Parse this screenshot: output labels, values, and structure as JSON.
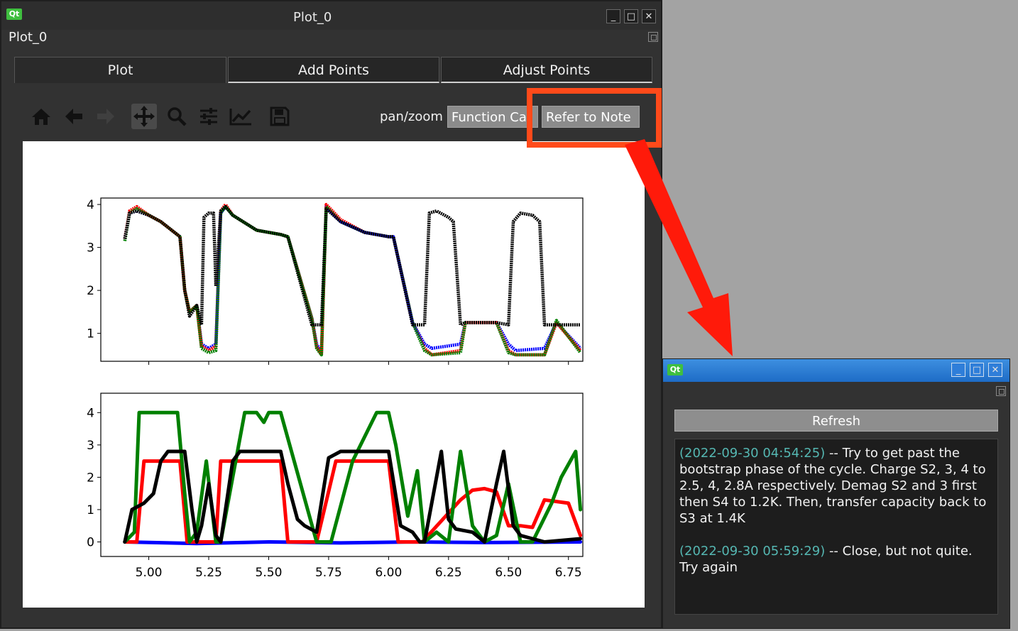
{
  "main_window": {
    "title": "Plot_0",
    "dock_label": "Plot_0",
    "controls": {
      "minimize": "_",
      "maximize": "□",
      "close": "✕"
    }
  },
  "tabs": [
    {
      "label": "Plot",
      "active": true
    },
    {
      "label": "Add Points",
      "active": false
    },
    {
      "label": "Adjust Points",
      "active": false
    }
  ],
  "toolbar": {
    "icons": [
      "home-icon",
      "back-arrow-icon",
      "forward-arrow-icon",
      "pan-move-icon",
      "zoom-icon",
      "configure-subplots-icon",
      "edit-axis-icon",
      "save-icon"
    ],
    "mode_label": "pan/zoom",
    "function_button_label": "Function Ca",
    "refer_button_label": "Refer to Note"
  },
  "annotation": {
    "color": "#ff4a1a",
    "arrow_color": "#ff1a0a"
  },
  "chart_data": [
    {
      "type": "scatter",
      "title": "",
      "xlabel": "",
      "ylabel": "",
      "xlim": [
        4.8,
        6.81
      ],
      "ylim": [
        0.35,
        4.15
      ],
      "yticks": [
        "1",
        "2",
        "3",
        "4"
      ],
      "series": [
        {
          "color": "#0000ff",
          "x": [
            4.9,
            4.92,
            4.95,
            5.0,
            5.05,
            5.13,
            5.15,
            5.17,
            5.2,
            5.22,
            5.25,
            5.28,
            5.3,
            5.32,
            5.35,
            5.45,
            5.55,
            5.58,
            5.68,
            5.7,
            5.72,
            5.74,
            5.8,
            5.9,
            6.0,
            6.02,
            6.1,
            6.15,
            6.18,
            6.3,
            6.32,
            6.45,
            6.5,
            6.53,
            6.65,
            6.7,
            6.8
          ],
          "y": [
            3.2,
            3.8,
            3.85,
            3.75,
            3.6,
            3.25,
            2.0,
            1.5,
            1.65,
            0.75,
            0.65,
            0.75,
            3.8,
            3.95,
            3.75,
            3.4,
            3.3,
            3.25,
            1.35,
            0.75,
            0.55,
            3.95,
            3.6,
            3.35,
            3.25,
            3.25,
            1.25,
            0.75,
            0.65,
            0.75,
            1.25,
            1.25,
            0.75,
            0.6,
            0.65,
            1.25,
            0.65
          ]
        },
        {
          "color": "#ff0000",
          "x": [
            4.9,
            4.92,
            4.95,
            5.0,
            5.05,
            5.13,
            5.15,
            5.17,
            5.2,
            5.22,
            5.25,
            5.28,
            5.3,
            5.32,
            5.35,
            5.45,
            5.55,
            5.58,
            5.68,
            5.7,
            5.72,
            5.74,
            5.8,
            5.9,
            6.0,
            6.02,
            6.1,
            6.15,
            6.18,
            6.3,
            6.32,
            6.45,
            6.5,
            6.53,
            6.65,
            6.7,
            6.8
          ],
          "y": [
            3.2,
            3.85,
            3.95,
            3.75,
            3.6,
            3.25,
            2.0,
            1.5,
            1.65,
            0.7,
            0.6,
            0.7,
            3.85,
            4.0,
            3.75,
            3.4,
            3.3,
            3.25,
            1.35,
            0.7,
            0.5,
            4.0,
            3.65,
            3.35,
            3.25,
            3.25,
            1.25,
            0.65,
            0.5,
            0.6,
            1.25,
            1.25,
            0.6,
            0.5,
            0.5,
            1.25,
            0.6
          ]
        },
        {
          "color": "#008000",
          "x": [
            4.9,
            4.92,
            4.95,
            5.0,
            5.05,
            5.13,
            5.15,
            5.17,
            5.2,
            5.22,
            5.25,
            5.28,
            5.3,
            5.32,
            5.35,
            5.45,
            5.55,
            5.58,
            5.68,
            5.7,
            5.72,
            5.74,
            5.8,
            5.9,
            6.0,
            6.02,
            6.1,
            6.15,
            6.18,
            6.3,
            6.32,
            6.45,
            6.5,
            6.53,
            6.65,
            6.7,
            6.8
          ],
          "y": [
            3.15,
            3.8,
            3.9,
            3.75,
            3.6,
            3.25,
            2.0,
            1.5,
            1.65,
            0.65,
            0.55,
            0.6,
            3.8,
            3.95,
            3.75,
            3.4,
            3.3,
            3.25,
            1.35,
            0.65,
            0.5,
            3.95,
            3.6,
            3.35,
            3.25,
            3.25,
            1.25,
            0.6,
            0.5,
            0.55,
            1.25,
            1.25,
            0.55,
            0.5,
            0.5,
            1.3,
            0.55
          ]
        },
        {
          "color": "#000000",
          "x": [
            4.9,
            4.92,
            4.95,
            5.0,
            5.05,
            5.13,
            5.15,
            5.17,
            5.2,
            5.22,
            5.23,
            5.25,
            5.27,
            5.28,
            5.3,
            5.32,
            5.35,
            5.45,
            5.55,
            5.58,
            5.68,
            5.7,
            5.72,
            5.74,
            5.8,
            5.9,
            6.0,
            6.02,
            6.1,
            6.15,
            6.17,
            6.2,
            6.25,
            6.27,
            6.3,
            6.32,
            6.45,
            6.5,
            6.52,
            6.55,
            6.6,
            6.63,
            6.65,
            6.8
          ],
          "y": [
            3.2,
            3.8,
            3.85,
            3.75,
            3.6,
            3.25,
            2.0,
            1.4,
            1.65,
            1.2,
            3.7,
            3.8,
            3.8,
            2.1,
            3.85,
            3.95,
            3.75,
            3.4,
            3.3,
            3.25,
            1.2,
            1.2,
            1.2,
            3.9,
            3.6,
            3.35,
            3.25,
            3.25,
            1.2,
            1.2,
            3.8,
            3.85,
            3.7,
            3.6,
            1.2,
            1.25,
            1.25,
            1.2,
            3.6,
            3.8,
            3.75,
            3.6,
            1.2,
            1.2
          ]
        }
      ]
    },
    {
      "type": "line",
      "title": "",
      "xlabel": "",
      "ylabel": "",
      "xlim": [
        4.8,
        6.81
      ],
      "ylim": [
        -0.45,
        4.6
      ],
      "yticks": [
        "0",
        "1",
        "2",
        "3",
        "4"
      ],
      "xticks": [
        "5.00",
        "5.25",
        "5.50",
        "5.75",
        "6.00",
        "6.25",
        "6.50",
        "6.75"
      ],
      "series": [
        {
          "color": "#0000ff",
          "x": [
            4.9,
            5.2,
            5.5,
            5.8,
            6.1,
            6.4,
            6.8
          ],
          "y": [
            0.0,
            -0.05,
            0.0,
            -0.03,
            0.0,
            -0.02,
            0.0
          ]
        },
        {
          "color": "#ff0000",
          "x": [
            4.9,
            4.95,
            4.98,
            5.05,
            5.13,
            5.16,
            5.26,
            5.28,
            5.3,
            5.32,
            5.38,
            5.4,
            5.45,
            5.55,
            5.58,
            5.68,
            5.7,
            5.78,
            5.8,
            5.85,
            5.9,
            6.0,
            6.04,
            6.12,
            6.14,
            6.3,
            6.35,
            6.4,
            6.45,
            6.5,
            6.55,
            6.6,
            6.65,
            6.75,
            6.8
          ],
          "y": [
            0.0,
            0.0,
            2.5,
            2.5,
            2.5,
            0.0,
            0.0,
            0.0,
            2.5,
            2.5,
            2.5,
            2.5,
            2.5,
            2.5,
            0.0,
            0.0,
            0.0,
            2.5,
            2.5,
            2.5,
            2.5,
            2.5,
            0.0,
            0.0,
            0.0,
            1.3,
            1.6,
            1.65,
            1.55,
            0.5,
            0.5,
            0.45,
            1.3,
            1.2,
            0.2
          ]
        },
        {
          "color": "#008000",
          "x": [
            4.9,
            4.94,
            4.96,
            5.05,
            5.12,
            5.15,
            5.17,
            5.2,
            5.24,
            5.28,
            5.3,
            5.4,
            5.45,
            5.48,
            5.5,
            5.55,
            5.7,
            5.74,
            5.76,
            5.85,
            5.95,
            6.0,
            6.03,
            6.08,
            6.12,
            6.15,
            6.2,
            6.25,
            6.3,
            6.35,
            6.4,
            6.45,
            6.5,
            6.55,
            6.6,
            6.68,
            6.72,
            6.78,
            6.8
          ],
          "y": [
            0.0,
            0.3,
            4.0,
            4.0,
            4.0,
            1.5,
            0.0,
            0.3,
            2.5,
            0.0,
            0.0,
            4.0,
            4.0,
            3.7,
            4.0,
            4.0,
            0.0,
            0.0,
            0.0,
            2.5,
            4.0,
            4.0,
            3.0,
            0.8,
            2.2,
            0.0,
            0.3,
            0.0,
            2.8,
            0.5,
            0.0,
            0.2,
            1.8,
            0.0,
            0.0,
            1.2,
            2.0,
            2.8,
            1.0
          ]
        },
        {
          "color": "#000000",
          "x": [
            4.9,
            4.93,
            4.98,
            5.02,
            5.05,
            5.08,
            5.13,
            5.15,
            5.18,
            5.2,
            5.22,
            5.25,
            5.28,
            5.3,
            5.35,
            5.38,
            5.45,
            5.5,
            5.55,
            5.58,
            5.62,
            5.65,
            5.7,
            5.75,
            5.8,
            5.85,
            5.9,
            5.95,
            6.0,
            6.05,
            6.1,
            6.13,
            6.15,
            6.22,
            6.25,
            6.28,
            6.35,
            6.4,
            6.45,
            6.48,
            6.52,
            6.55,
            6.6,
            6.65,
            6.8
          ],
          "y": [
            0.0,
            1.0,
            1.2,
            1.5,
            2.5,
            2.8,
            2.8,
            2.8,
            1.0,
            0.0,
            0.5,
            1.8,
            0.2,
            0.0,
            2.5,
            2.8,
            2.8,
            2.8,
            2.8,
            1.8,
            0.7,
            0.5,
            0.3,
            2.6,
            2.8,
            2.8,
            2.8,
            2.8,
            2.8,
            0.5,
            0.3,
            0.0,
            0.0,
            2.8,
            0.7,
            0.4,
            0.3,
            0.0,
            1.8,
            2.8,
            0.5,
            0.2,
            0.1,
            0.0,
            0.1
          ]
        }
      ]
    }
  ],
  "notes_window": {
    "controls": {
      "minimize": "_",
      "maximize": "□",
      "close": "✕"
    },
    "refresh_label": "Refresh",
    "entries": [
      {
        "timestamp": "(2022-09-30 04:54:25)",
        "text": " -- Try to get past the bootstrap phase of the cycle. Charge S2, 3, 4 to 2.5, 4, 2.8A respectively. Demag S2 and 3 first then S4 to 1.2K. Then, transfer capacity back to S3 at 1.4K"
      },
      {
        "timestamp": "(2022-09-30 05:59:29)",
        "text": " -- Close, but not quite. Try again"
      }
    ]
  }
}
